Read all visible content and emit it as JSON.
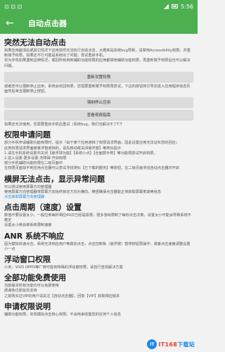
{
  "status_bar": {
    "time": "5:56"
  },
  "app_bar": {
    "title": "自动点击器",
    "back_icon": "arrow-left-icon"
  },
  "sections": {
    "s1_title": "突然无法自动点击",
    "s1_p1": "如果应用崩溃后或其它情况下应用突然无法执行自动点击，大概率是系统bug导致，请禁用Accessibility权限，并重新授予权限。如果还不行可能是系统出了问题，尝试重启手机。",
    "s1_p2": "另为手机如果遇到这种情况，或回所有用到辅助功能权限的应用都禁用辅助功能权限，再重新赋予权限后也可以解决问题。",
    "btn_reset": "重新设置权限",
    "s1_p3": "或者您可以强制停止应用，系统会收回权限，您需要重新赋予权限再尝试，下边的按钮将引导您进入应用程序信息页面然后单击强制停止按钮。",
    "btn_force_stop": "强制停止应用",
    "btn_video": "查看视频指南",
    "s1_p4": "如果还无法使用，您需要重启手机后重试（系统bug，我们也解决不了T.T",
    "s2_title": "权限申请问题",
    "s2_p1": "部分手机申请辅助功能权限时，提示『由于某个应用遮挡了权限请求界面，因此设置应用无法证实您的回应』",
    "s2_p2": "此类权限请求界面被悬浮窗遮挡的，请先移动或关闭悬浮窗】等类似提示",
    "s2_p3": "1.请在手机系统设置中关闭【悬浮球功能】【系统小点】【全面屏手势】等功能再尝试开启权限。",
    "s2_p4": "2.进入设置-更多设置-无障碍-开启权限",
    "s2_p5": "部分手机辅助功能权限在二级页面中",
    "s2_p6": "在权限页面找不到应用点击器可以尝试寻找类似【已下载的服务】等按钮，在二级页面寻找自动点击器并开启",
    "s3_title": "横屏无法点击，显示异常问题",
    "s3_p1": "可以尝试使用屏幕方向管理器",
    "s3_p2": "使用屏幕方向管理器将屏幕方向始终锁定方向为横向，横竖确保点击器能正常获取屏幕宽高等信息",
    "s3_link": "点击获取屏幕方向管理器",
    "s4_title": "点击周期（速度）设置",
    "s4_p1": "数值不要设置太小，一般应用每秒相应60次已经是极限，很多游戏限制了每秒点击次数，设置太小可能会导致系统不稳定",
    "s4_p2": "设置太小使会被系统限制速度",
    "s5_title": "ANR 系统不响应",
    "s5_p1": "因为模拟快速点击，系统无法响应用户等真实点击，点击控制板（悬浮窗）暂停按钮再操作，或者点击速度调整设置小一点",
    "s6_title": "浮动窗口权限",
    "s6_p1": "小米，VIVO OPPO等厂商可能有特殊的浮动窗权限，请自行查找解决方案",
    "s7_title": "全部功能免费使用",
    "s7_p1": "当前版本所有功能均可以免费使用",
    "s7_p2": "感谢各位朋友的支持",
    "s7_p3": "之前购买过VIP的用户请关注【自动点击器】，回复【VIP】获取相应版本",
    "s8_title": "申请权限说明",
    "s8_p1": "辅助功能权限，实现模拟点击核心权限。不会用来收集您的任何个人信息"
  },
  "watermark": {
    "logo": "IT",
    "text_a": "IT168",
    "text_b": "下载站"
  }
}
